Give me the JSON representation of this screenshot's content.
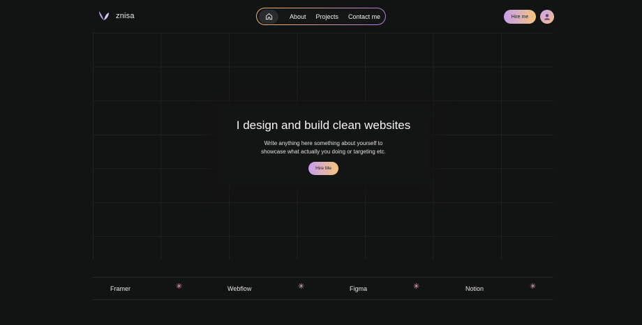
{
  "brand": {
    "name": "znisa",
    "logo_icon": "leaf-logo-icon"
  },
  "nav": {
    "home_icon": "home-icon",
    "links": [
      "About",
      "Projects",
      "Contact me"
    ]
  },
  "header": {
    "hire_label": "Hire me",
    "avatar_icon": "user-avatar-icon"
  },
  "hero": {
    "title": "I design and build clean websites",
    "subtitle_line1": "Write anything here something about yourself to",
    "subtitle_line2": "showcase what actually you doing or targeting etc.",
    "button_label": "Hire Me"
  },
  "tools": [
    "Framer",
    "Webflow",
    "Figma",
    "Notion"
  ],
  "colors": {
    "background": "#121313",
    "accent_start": "#c79ef0",
    "accent_end": "#f3c47b",
    "star": "#f1a8c6"
  }
}
